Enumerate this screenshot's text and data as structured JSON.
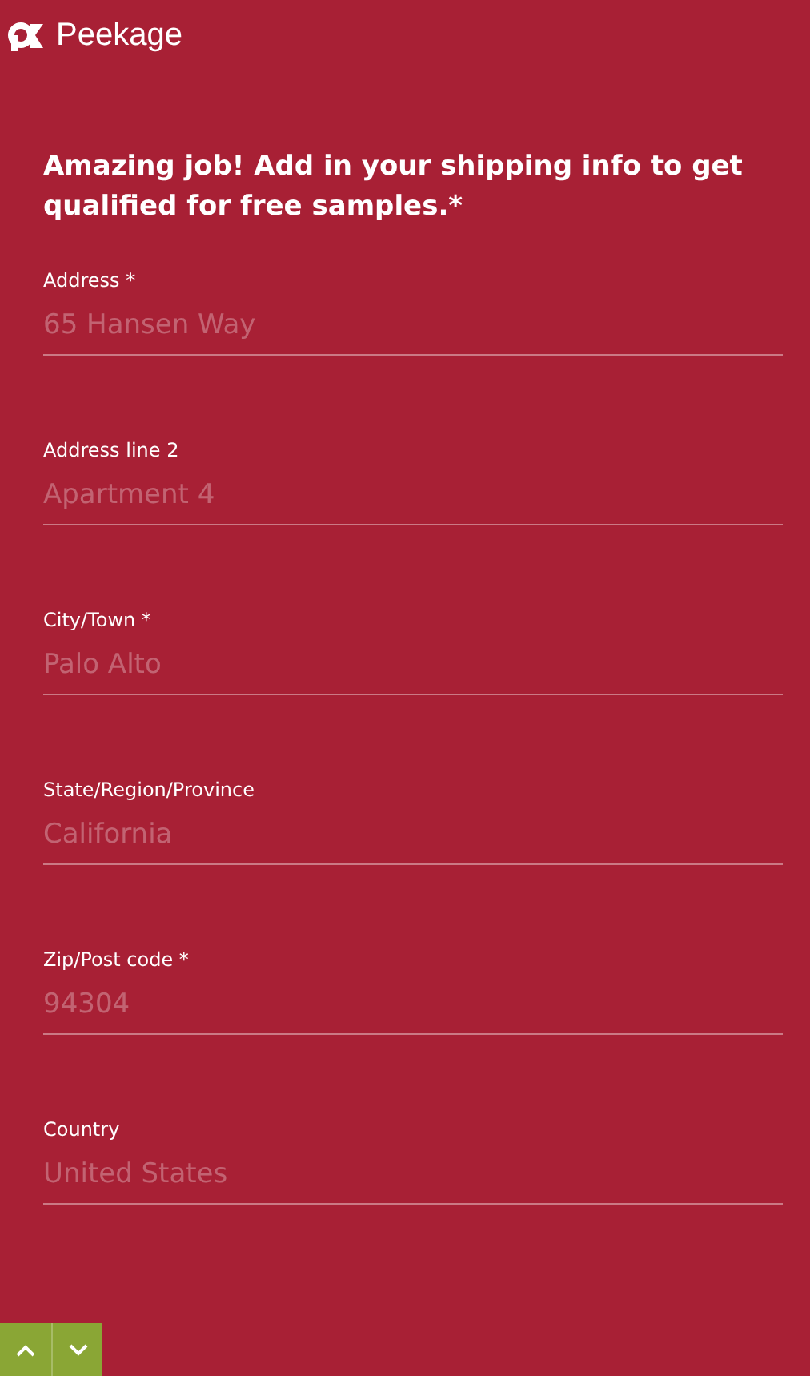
{
  "header": {
    "brand": "Peekage"
  },
  "heading": "Amazing job! Add in your shipping info to get qualified for free samples.*",
  "fields": [
    {
      "label": "Address *",
      "placeholder": "65 Hansen Way"
    },
    {
      "label": "Address line 2",
      "placeholder": "Apartment 4"
    },
    {
      "label": "City/Town *",
      "placeholder": "Palo Alto"
    },
    {
      "label": "State/Region/Province",
      "placeholder": "California"
    },
    {
      "label": "Zip/Post code *",
      "placeholder": "94304"
    },
    {
      "label": "Country",
      "placeholder": "United States"
    }
  ]
}
